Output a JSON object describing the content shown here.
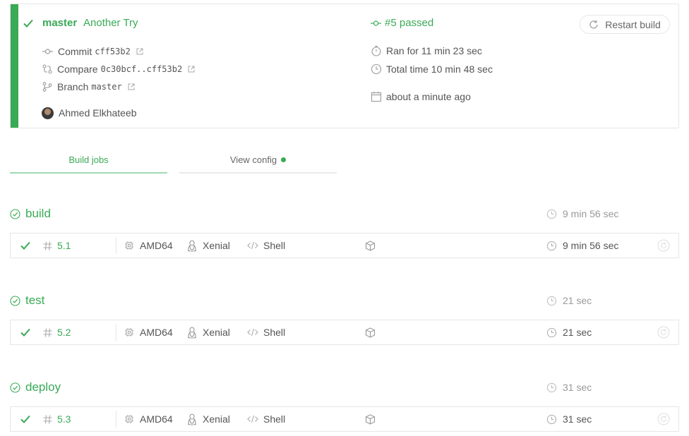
{
  "build": {
    "branch": "master",
    "commit_message": "Another Try",
    "status": "#5 passed",
    "restart_label": "Restart build",
    "commit_label": "Commit",
    "commit_sha": "cff53b2",
    "compare_label": "Compare",
    "compare_range": "0c30bcf..cff53b2",
    "branch_label": "Branch",
    "branch_value": "master",
    "author": "Ahmed Elkhateeb",
    "ran_for": "Ran for 11 min 23 sec",
    "total_time": "Total time 10 min 48 sec",
    "finished": "about a minute ago"
  },
  "tabs": {
    "build_jobs": "Build jobs",
    "view_config": "View config"
  },
  "stages": [
    {
      "name": "build",
      "duration": "9 min 56 sec",
      "job": {
        "number": "5.1",
        "arch": "AMD64",
        "os": "Xenial",
        "language": "Shell",
        "duration": "9 min 56 sec"
      }
    },
    {
      "name": "test",
      "duration": "21 sec",
      "job": {
        "number": "5.2",
        "arch": "AMD64",
        "os": "Xenial",
        "language": "Shell",
        "duration": "21 sec"
      }
    },
    {
      "name": "deploy",
      "duration": "31 sec",
      "job": {
        "number": "5.3",
        "arch": "AMD64",
        "os": "Xenial",
        "language": "Shell",
        "duration": "31 sec"
      }
    }
  ],
  "colors": {
    "passed_green": "#39aa56",
    "border": "#e6e6e6",
    "muted_text": "#999999"
  }
}
